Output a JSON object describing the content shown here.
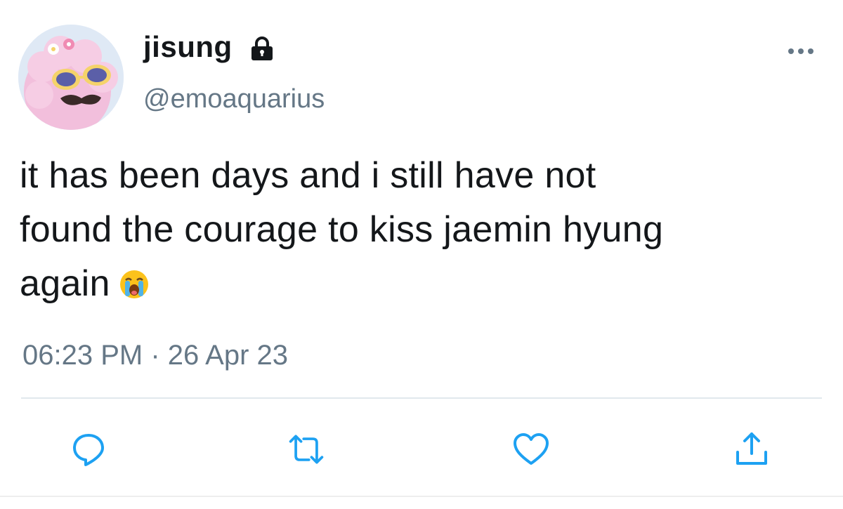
{
  "tweet": {
    "display_name": "jisung",
    "handle": "@emoaquarius",
    "text_lines": [
      "it has been days and i still have not",
      "found the courage to kiss jaemin hyung",
      "again"
    ],
    "emoji": "loudly-crying-face-emoji",
    "timestamp": "06:23 PM · 26 Apr 23",
    "protected_icon": "lock-icon",
    "more_icon": "more-horizontal-icon"
  },
  "actions": [
    {
      "icon": "reply-icon"
    },
    {
      "icon": "retweet-icon"
    },
    {
      "icon": "like-icon"
    },
    {
      "icon": "share-icon"
    }
  ],
  "colors": {
    "text": "#14171a",
    "secondary": "#657786",
    "icon": "#1da1f2",
    "divider": "#e1e8ed"
  }
}
